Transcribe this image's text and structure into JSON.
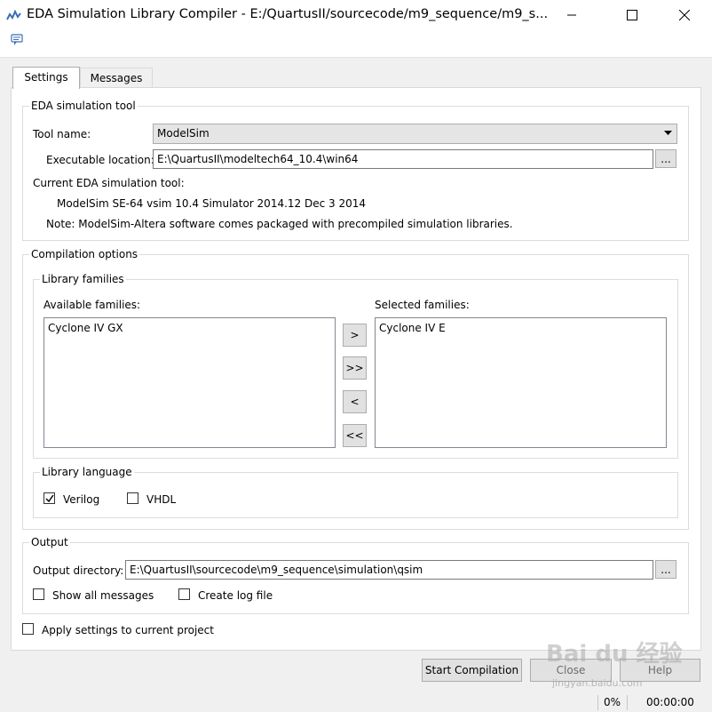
{
  "window": {
    "title": "EDA Simulation Library Compiler - E:/QuartusII/sourcecode/m9_sequence/m9_s..."
  },
  "tabs": [
    {
      "label": "Settings",
      "active": true
    },
    {
      "label": "Messages",
      "active": false
    }
  ],
  "eda_tool": {
    "group_label": "EDA simulation tool",
    "tool_name_label": "Tool name:",
    "tool_name_value": "ModelSim",
    "exe_label": "Executable location:",
    "exe_value": "E:\\QuartusII\\modeltech64_10.4\\win64",
    "browse_label": "...",
    "current_label": "Current EDA simulation tool:",
    "current_value": "ModelSim SE-64 vsim 10.4 Simulator 2014.12 Dec  3 2014",
    "note": "Note: ModelSim-Altera software comes packaged with precompiled simulation libraries."
  },
  "compilation": {
    "group_label": "Compilation options",
    "families_label": "Library families",
    "available_label": "Available families:",
    "available_items": [
      "Cyclone IV GX"
    ],
    "selected_label": "Selected families:",
    "selected_items": [
      "Cyclone IV E"
    ],
    "move_buttons": [
      ">",
      ">>",
      "<",
      "<<"
    ],
    "language_label": "Library language",
    "languages": [
      {
        "label": "Verilog",
        "checked": true
      },
      {
        "label": "VHDL",
        "checked": false
      }
    ]
  },
  "output": {
    "group_label": "Output",
    "dir_label": "Output directory:",
    "dir_value": "E:\\QuartusII\\sourcecode\\m9_sequence\\simulation\\qsim",
    "browse_label": "...",
    "show_all_label": "Show all messages",
    "create_log_label": "Create log file"
  },
  "apply_label": "Apply settings to current project",
  "buttons": {
    "start": "Start Compilation",
    "close": "Close",
    "help": "Help"
  },
  "status": {
    "progress": "0%",
    "time": "00:00:00"
  },
  "watermark": {
    "brand": "Bai du 经验",
    "url": "jingyan.baidu.com"
  }
}
